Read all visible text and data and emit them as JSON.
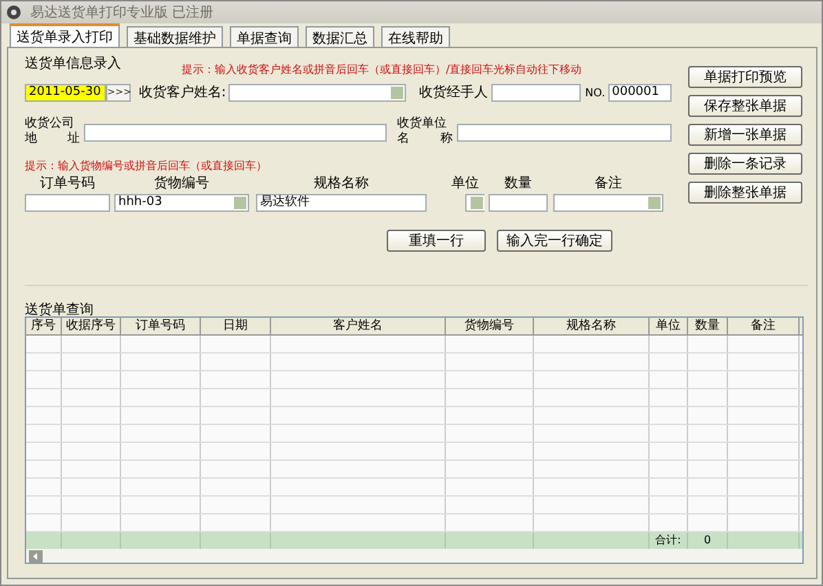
{
  "window": {
    "title": "易达送货单打印专业版 已注册"
  },
  "tabs": [
    {
      "label": "送货单录入打印",
      "selected": true
    },
    {
      "label": "基础数据维护",
      "selected": false
    },
    {
      "label": "单据查询",
      "selected": false
    },
    {
      "label": "数据汇总",
      "selected": false
    },
    {
      "label": "在线帮助",
      "selected": false
    }
  ],
  "entry": {
    "title": "送货单信息录入",
    "hint": "提示：输入收货客户姓名或拼音后回车（或直接回车）/直接回车光标自动往下移动",
    "date": {
      "value": "2011-05-30"
    },
    "date_button": ">>>",
    "customer": {
      "label": "收货客户姓名:"
    },
    "handler": {
      "label": "收货经手人"
    },
    "number": {
      "label": "NO.",
      "value": "000001"
    },
    "address": {
      "label_top": "收货公司",
      "label_bottom": [
        "地",
        "址"
      ]
    },
    "unit": {
      "label_top": "收货单位",
      "label_bottom": [
        "名",
        "称"
      ]
    },
    "item_hint": "提示：输入货物编号或拼音后回车（或直接回车）",
    "item_fields": [
      {
        "label": "订单号码",
        "kind": "text"
      },
      {
        "label": "货物编号",
        "kind": "combo",
        "value": "hhh-03"
      },
      {
        "label": "规格名称",
        "kind": "text",
        "value": "易达软件"
      },
      {
        "label": "单位",
        "kind": "combo"
      },
      {
        "label": "数量",
        "kind": "text"
      },
      {
        "label": "备注",
        "kind": "combo"
      }
    ],
    "row_buttons": [
      "重填一行",
      "输入完一行确定"
    ]
  },
  "side_buttons": [
    "单据打印预览",
    "保存整张单据",
    "新增一张单据",
    "删除一条记录",
    "删除整张单据"
  ],
  "query": {
    "title": "送货单查询",
    "columns": [
      "序号",
      "收据序号",
      "订单号码",
      "日期",
      "客户姓名",
      "货物编号",
      "规格名称",
      "单位",
      "数量",
      "备注"
    ],
    "footer": {
      "label": "合计:",
      "value": "0"
    }
  }
}
